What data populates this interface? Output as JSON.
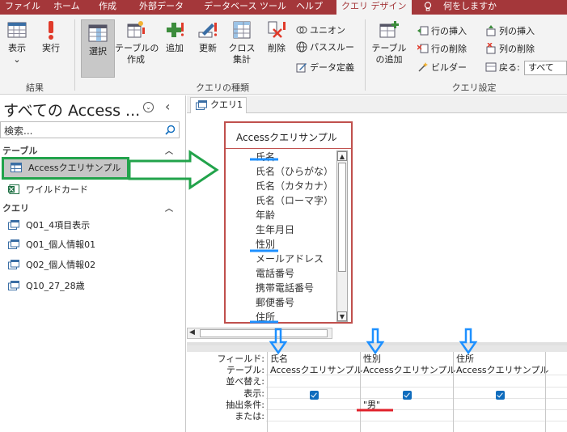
{
  "ribbon_tabs": {
    "file": "ファイル",
    "home": "ホーム",
    "create": "作成",
    "external_data": "外部データ",
    "database_tools": "データベース ツール",
    "help": "ヘルプ",
    "query_design": "クエリ デザイン",
    "tell_me": "何をしますか"
  },
  "ribbon": {
    "results": {
      "view": "表示",
      "run": "実行",
      "group": "結果"
    },
    "query_type": {
      "select": "選択",
      "make_table_1": "テーブルの",
      "make_table_2": "作成",
      "append": "追加",
      "update": "更新",
      "crosstab_1": "クロス",
      "crosstab_2": "集計",
      "delete": "削除",
      "union": "ユニオン",
      "pass_through": "パススルー",
      "data_definition": "データ定義",
      "group": "クエリの種類"
    },
    "query_setup": {
      "add_table_1": "テーブル",
      "add_table_2": "の追加",
      "insert_rows": "行の挿入",
      "delete_rows": "行の削除",
      "builder": "ビルダー",
      "insert_columns": "列の挿入",
      "delete_columns": "列の削除",
      "return_label": "戻る:",
      "return_value": "すべて",
      "group": "クエリ設定"
    }
  },
  "nav": {
    "title": "すべての Access ...",
    "search_placeholder": "検索...",
    "tables_section": "テーブル",
    "queries_section": "クエリ",
    "tables": [
      "Accessクエリサンプル",
      "ワイルドカード"
    ],
    "queries": [
      "Q01_4項目表示",
      "Q01_個人情報01",
      "Q02_個人情報02",
      "Q10_27_28歳"
    ]
  },
  "doc_tab": "クエリ1",
  "table_box": {
    "title": "Accessクエリサンプル",
    "fields": [
      "氏名",
      "氏名（ひらがな）",
      "氏名（カタカナ）",
      "氏名（ローマ字）",
      "年齢",
      "生年月日",
      "性別",
      "メールアドレス",
      "電話番号",
      "携帯電話番号",
      "郵便番号",
      "住所"
    ]
  },
  "grid": {
    "row_labels": [
      "フィールド:",
      "テーブル:",
      "並べ替え:",
      "表示:",
      "抽出条件:",
      "または:"
    ],
    "columns": [
      {
        "field": "氏名",
        "table": "Accessクエリサンプル",
        "sort": "",
        "show": true,
        "criteria": ""
      },
      {
        "field": "性別",
        "table": "Accessクエリサンプル",
        "sort": "",
        "show": true,
        "criteria": "\"男\""
      },
      {
        "field": "住所",
        "table": "Accessクエリサンプル",
        "sort": "",
        "show": true,
        "criteria": ""
      }
    ]
  },
  "colors": {
    "accent": "#a4373a",
    "annotation_blue": "#1e90ff",
    "annotation_green": "#22a34b",
    "annotation_red": "#e0202a"
  }
}
